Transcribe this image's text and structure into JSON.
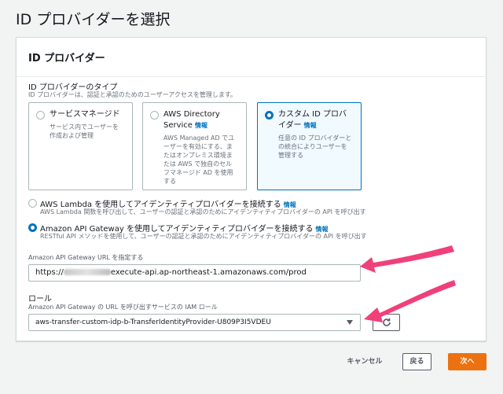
{
  "page": {
    "title": "ID プロバイダーを選択"
  },
  "panel": {
    "header": "ID プロバイダー",
    "type_label": "ID プロバイダーのタイプ",
    "type_desc": "ID プロバイダーは、認証と承認のためのユーザーアクセスを管理します。",
    "tiles": [
      {
        "title": "サービスマネージド",
        "info": "",
        "desc": "サービス内でユーザーを作成および管理",
        "selected": false
      },
      {
        "title": "AWS Directory Service",
        "info": "情報",
        "desc": "AWS Managed AD でユーザーを有効にする、またはオンプレミス環境または AWS で独自のセルフマネージド AD を使用する",
        "selected": false
      },
      {
        "title": "カスタム ID プロバイダー",
        "info": "情報",
        "desc": "任意の ID プロバイダーとの統合によりユーザーを管理する",
        "selected": true
      }
    ],
    "options": [
      {
        "title": "AWS Lambda を使用してアイデンティティプロバイダーを接続する",
        "info": "情報",
        "desc": "AWS Lambda 関数を呼び出して、ユーザーの認証と承認のためにアイデンティティプロバイダーの API を呼び出す",
        "selected": false
      },
      {
        "title": "Amazon API Gateway を使用してアイデンティティプロバイダーを接続する",
        "info": "情報",
        "desc": "RESTful API メソッドを使用して、ユーザーの認証と承認のためにアイデンティティプロバイダーの API を呼び出す",
        "selected": true
      }
    ],
    "url_label": "Amazon API Gateway URL を指定する",
    "url_prefix": "https://",
    "url_suffix": "execute-api.ap-northeast-1.amazonaws.com/prod",
    "role_label": "ロール",
    "role_desc": "Amazon API Gateway の URL を呼び出すサービスの IAM ロール",
    "role_value": "aws-transfer-custom-idp-b-TransferIdentityProvider-U809P3I5VDEU"
  },
  "footer": {
    "cancel": "キャンセル",
    "back": "戻る",
    "next": "次へ"
  },
  "colors": {
    "accent": "#0073bb",
    "primary_button": "#ec7211",
    "annotation_arrow": "#f0407a"
  }
}
